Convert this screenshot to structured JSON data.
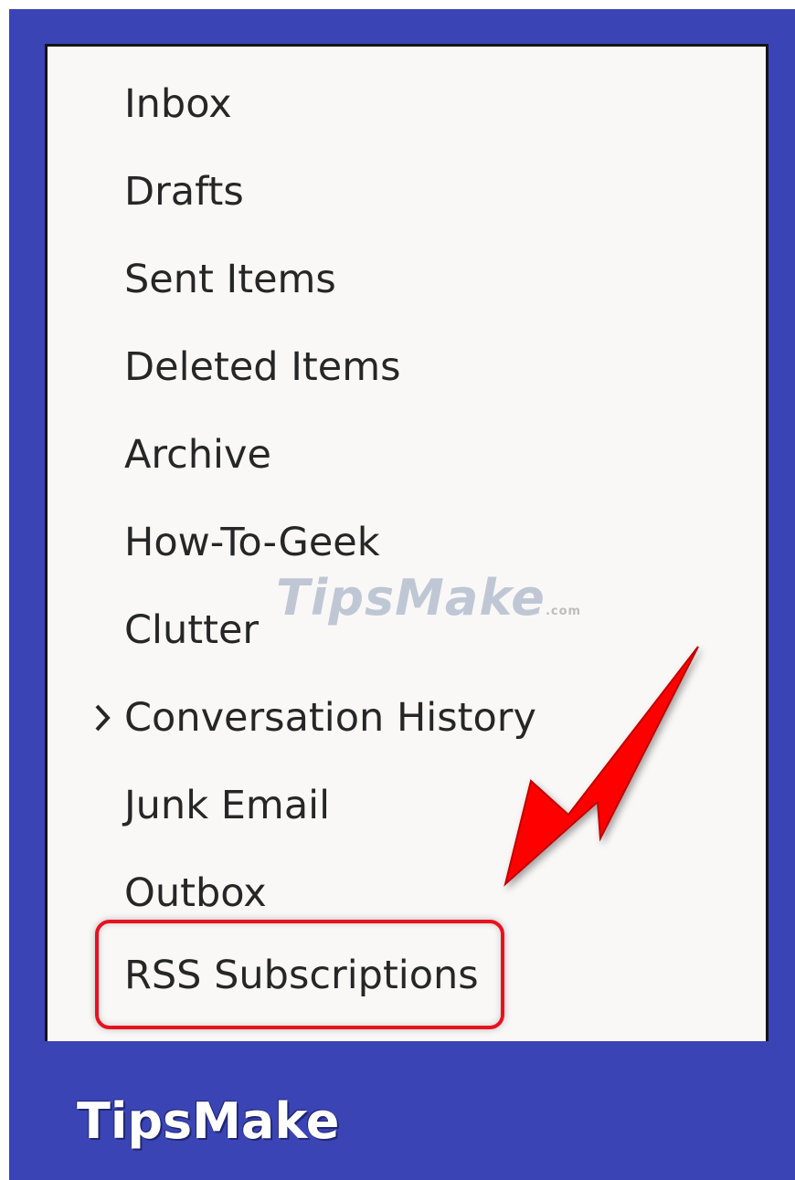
{
  "folders": [
    {
      "label": "Inbox"
    },
    {
      "label": "Drafts"
    },
    {
      "label": "Sent Items"
    },
    {
      "label": "Deleted Items"
    },
    {
      "label": "Archive"
    },
    {
      "label": "How-To-Geek"
    },
    {
      "label": "Clutter"
    },
    {
      "label": "Conversation History",
      "expandable": true
    },
    {
      "label": "Junk Email"
    },
    {
      "label": "Outbox"
    },
    {
      "label": "RSS Subscriptions",
      "highlighted": true
    }
  ],
  "watermark": {
    "text": "TipsMake",
    "suffix": ".com"
  },
  "brand": {
    "text": "TipsMake"
  },
  "colors": {
    "frame": "#3b44b4",
    "panel": "#f9f8f7",
    "highlight": "#e8111e",
    "arrow": "#ff0000"
  },
  "icons": {
    "expand": "chevron-right-icon",
    "pointer": "red-arrow"
  }
}
